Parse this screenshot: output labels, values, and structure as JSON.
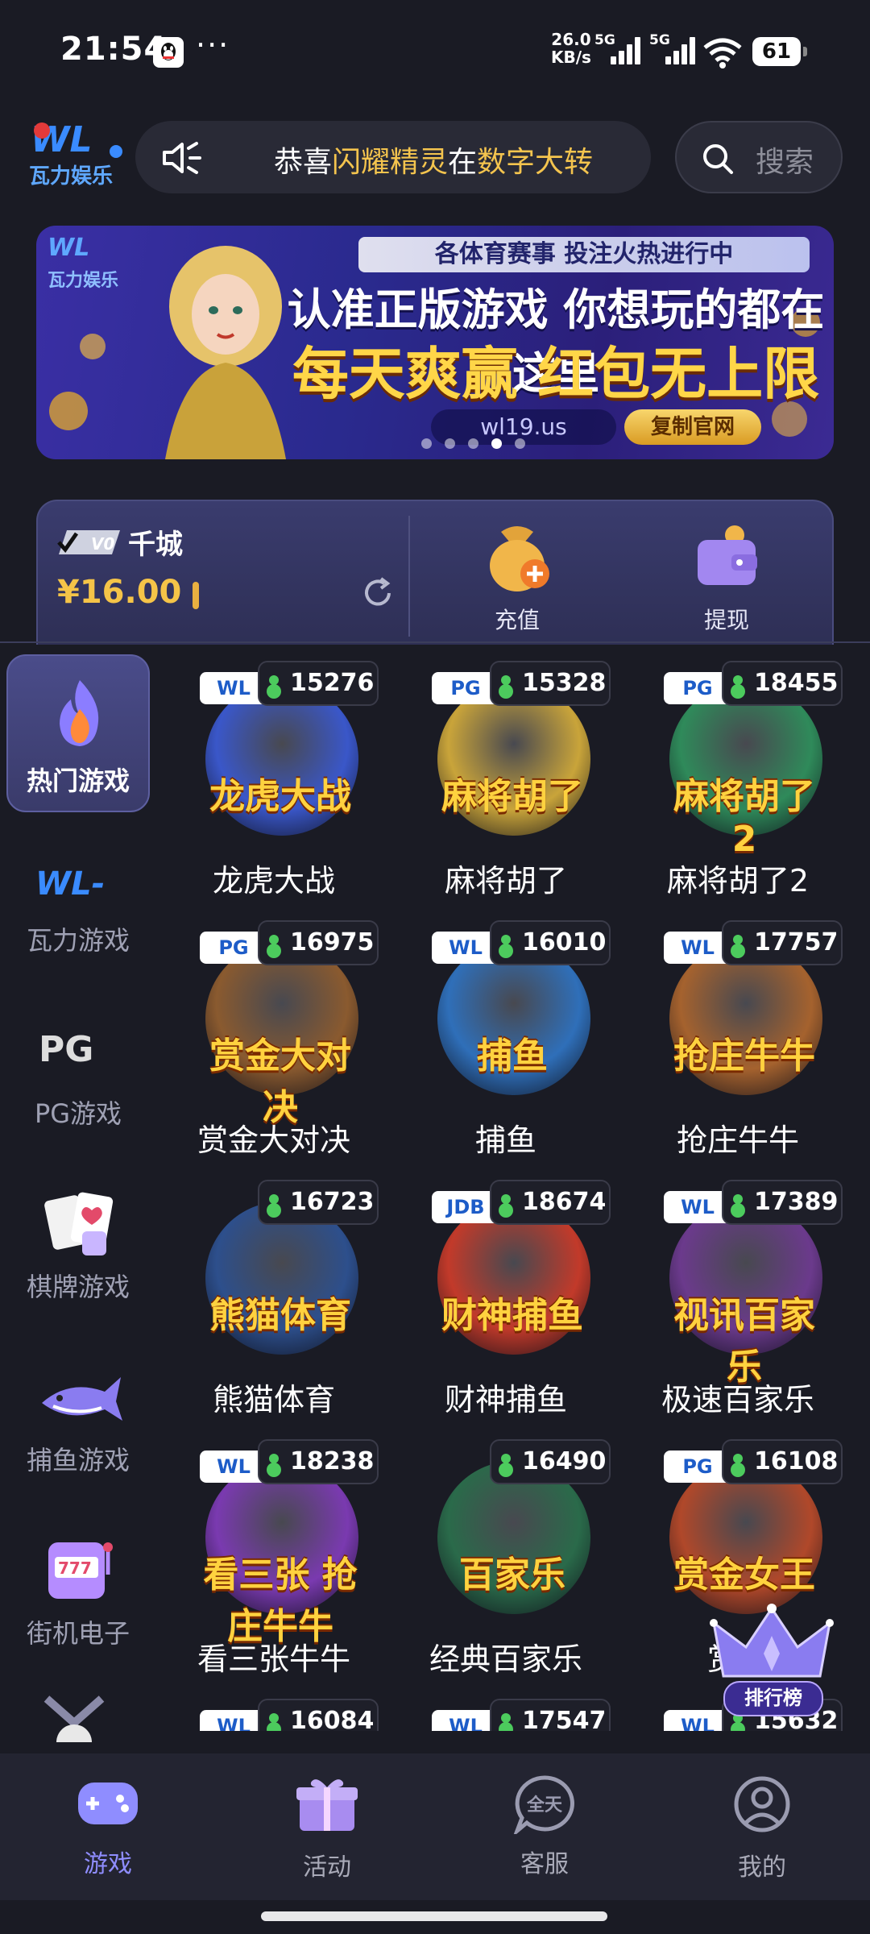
{
  "status_bar": {
    "time": "21:54",
    "more": "···",
    "net_speed_value": "26.0",
    "net_speed_unit": "KB/s",
    "sim1": "5G",
    "sim2": "5G",
    "battery": "61"
  },
  "header": {
    "logo_text": "瓦力娱乐",
    "notice": {
      "prefix": "恭喜",
      "player": "闪耀精灵",
      "mid": "在",
      "game": "数字大转"
    },
    "search_placeholder": "搜索"
  },
  "banner": {
    "line1": "各体育赛事  投注火热进行中",
    "line2": "认准正版游戏 你想玩的都在这里",
    "line3": "每天爽赢 红包无上限",
    "url": "wl19.us",
    "copy_button": "复制官网",
    "dots_total": 5,
    "active_dot": 4
  },
  "wallet": {
    "vip_badge": "V0",
    "username": "千城",
    "balance": "¥16.00",
    "deposit_label": "充值",
    "withdraw_label": "提现"
  },
  "sidebar": {
    "items": [
      {
        "label": "热门游戏",
        "icon": "flame-icon",
        "active": true
      },
      {
        "label": "瓦力游戏",
        "icon": "wali-logo-icon",
        "active": false
      },
      {
        "label": "PG游戏",
        "icon": "pg-logo-icon",
        "active": false
      },
      {
        "label": "棋牌游戏",
        "icon": "playing-cards-icon",
        "active": false
      },
      {
        "label": "捕鱼游戏",
        "icon": "shark-icon",
        "active": false
      },
      {
        "label": "街机电子",
        "icon": "slot-machine-icon",
        "active": false
      }
    ]
  },
  "games": [
    {
      "name": "龙虎大战",
      "provider": "WL",
      "players": "15276",
      "art": "龙虎大战",
      "color": "#3a57c9"
    },
    {
      "name": "麻将胡了",
      "provider": "PG",
      "players": "15328",
      "art": "麻将胡了",
      "color": "#c9a43a"
    },
    {
      "name": "麻将胡了2",
      "provider": "PG",
      "players": "18455",
      "art": "麻将胡了2",
      "color": "#2f8a5a"
    },
    {
      "name": "赏金大对决",
      "provider": "PG",
      "players": "16975",
      "art": "赏金大对决",
      "color": "#8a5a2f"
    },
    {
      "name": "捕鱼",
      "provider": "WL",
      "players": "16010",
      "art": "捕鱼",
      "color": "#2f6fb9"
    },
    {
      "name": "抢庄牛牛",
      "provider": "WL",
      "players": "17757",
      "art": "抢庄牛牛",
      "color": "#a5622e"
    },
    {
      "name": "熊猫体育",
      "provider": "",
      "players": "16723",
      "art": "熊猫体育",
      "color": "#2d4f8c"
    },
    {
      "name": "财神捕鱼",
      "provider": "JDB",
      "players": "18674",
      "art": "财神捕鱼",
      "color": "#c23a2a"
    },
    {
      "name": "极速百家乐",
      "provider": "WL",
      "players": "17389",
      "art": "视讯百家乐",
      "color": "#6b3a8c"
    },
    {
      "name": "看三张牛牛",
      "provider": "WL",
      "players": "18238",
      "art": "看三张 抢庄牛牛",
      "color": "#7a3ab0"
    },
    {
      "name": "经典百家乐",
      "provider": "",
      "players": "16490",
      "art": "百家乐",
      "color": "#2a6a4a"
    },
    {
      "name": "赏金",
      "provider": "PG",
      "players": "16108",
      "art": "赏金女王",
      "color": "#b0482a"
    },
    {
      "name": "",
      "provider": "WL",
      "players": "16084",
      "art": "",
      "color": "#3a3a6a"
    },
    {
      "name": "",
      "provider": "WL",
      "players": "17547",
      "art": "",
      "color": "#3a3a6a"
    },
    {
      "name": "",
      "provider": "WL",
      "players": "15632",
      "art": "",
      "color": "#3a3a6a"
    }
  ],
  "rank_badge": "排行榜",
  "bottom_nav": [
    {
      "label": "游戏",
      "icon": "gamepad-icon",
      "active": true
    },
    {
      "label": "活动",
      "icon": "gift-icon",
      "active": false
    },
    {
      "label": "客服",
      "icon": "chat-support-icon",
      "active": false,
      "badge": "全天"
    },
    {
      "label": "我的",
      "icon": "user-icon",
      "active": false
    }
  ],
  "colors": {
    "accent": "#8f8dff",
    "gold": "#f5c448",
    "background": "#1a1b24"
  }
}
